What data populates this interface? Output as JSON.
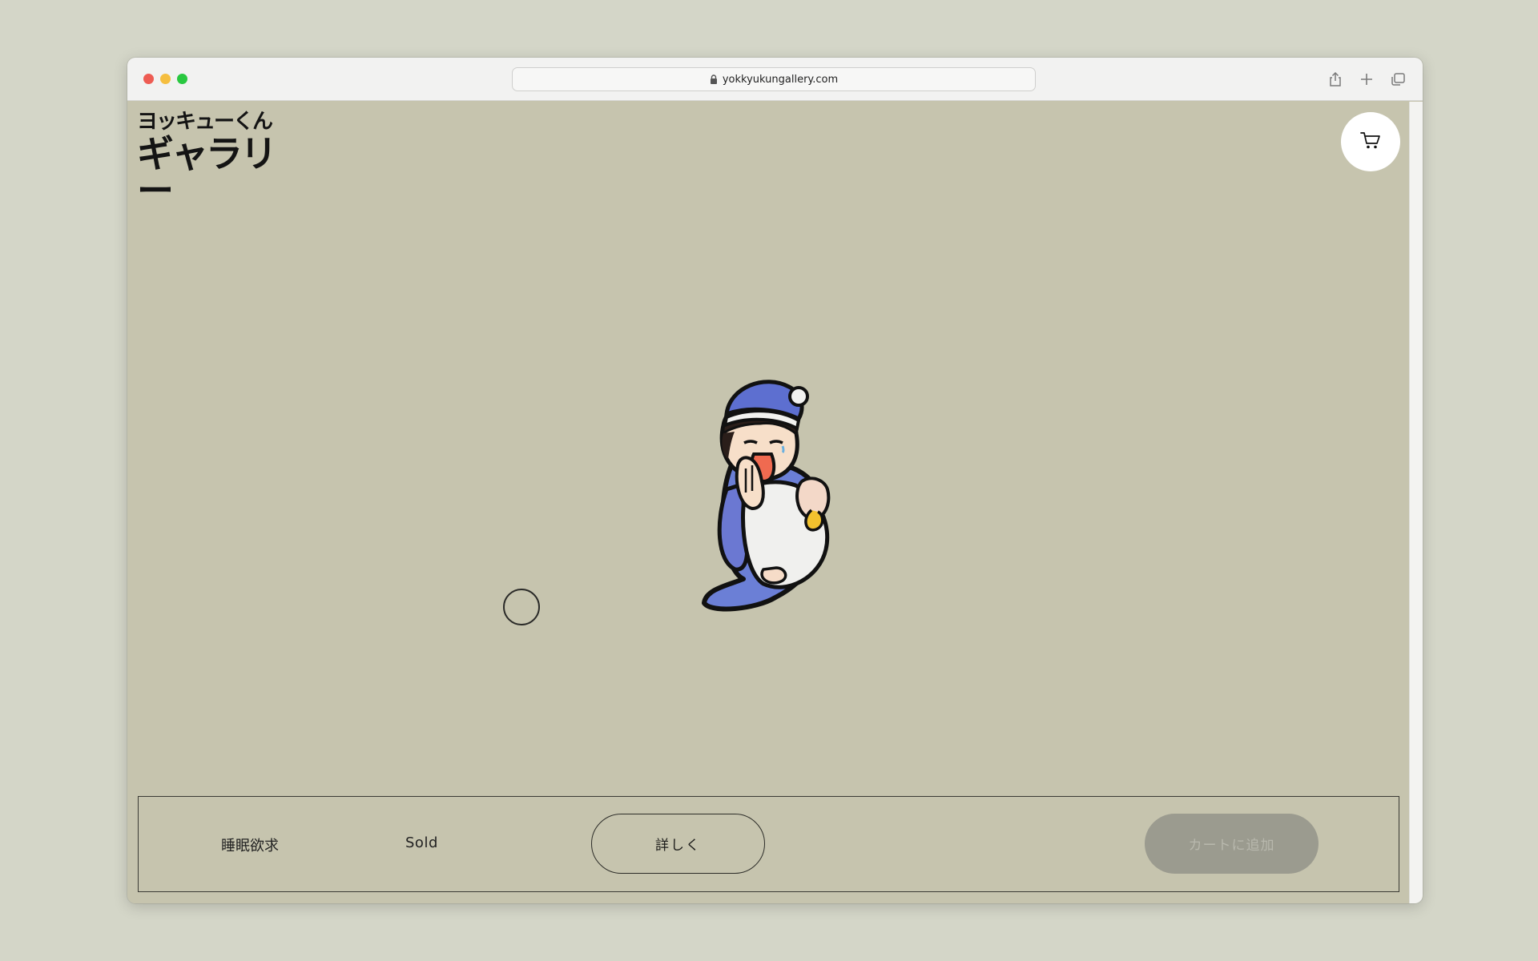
{
  "browser": {
    "url": "yokkyukungallery.com",
    "icons": [
      "lock-icon",
      "share-icon",
      "new-tab-icon",
      "tab-overview-icon"
    ]
  },
  "site": {
    "logo_line1": "ヨッキューくん",
    "logo_line2": "ギャラリー",
    "cart_icon": "cart-icon"
  },
  "product": {
    "name": "睡眠欲求",
    "status": "Sold",
    "details_label": "詳しく",
    "add_to_cart_label": "カートに追加"
  },
  "colors": {
    "page_background": "#c6c4ae",
    "outer_background": "#d4d6c8",
    "disabled_button": "#9b9b8f",
    "character_blue": "#6b7fd6"
  }
}
